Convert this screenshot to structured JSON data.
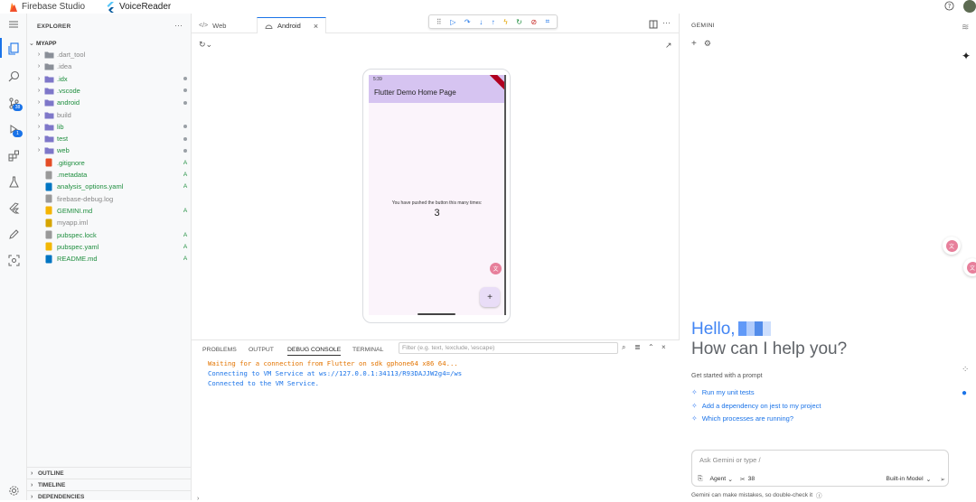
{
  "topbar": {
    "brand": "Firebase Studio",
    "project": "VoiceReader"
  },
  "activity": {
    "source_control_badge": "38",
    "debug_badge": "1"
  },
  "explorer": {
    "header": "EXPLORER",
    "root": "MYAPP",
    "items": [
      {
        "name": ".dart_tool",
        "status": "",
        "folder": true
      },
      {
        "name": ".idea",
        "status": "",
        "folder": true
      },
      {
        "name": ".idx",
        "status": "dot",
        "folder": true
      },
      {
        "name": ".vscode",
        "status": "dot",
        "folder": true
      },
      {
        "name": "android",
        "status": "dot",
        "folder": true
      },
      {
        "name": "build",
        "status": "",
        "folder": true
      },
      {
        "name": "lib",
        "status": "dot",
        "folder": true
      },
      {
        "name": "test",
        "status": "dot",
        "folder": true
      },
      {
        "name": "web",
        "status": "dot",
        "folder": true
      },
      {
        "name": ".gitignore",
        "status": "A",
        "folder": false
      },
      {
        "name": ".metadata",
        "status": "A",
        "folder": false
      },
      {
        "name": "analysis_options.yaml",
        "status": "A",
        "folder": false
      },
      {
        "name": "firebase-debug.log",
        "status": "",
        "folder": false
      },
      {
        "name": "GEMINI.md",
        "status": "A",
        "folder": false
      },
      {
        "name": "myapp.iml",
        "status": "",
        "folder": false
      },
      {
        "name": "pubspec.lock",
        "status": "A",
        "folder": false
      },
      {
        "name": "pubspec.yaml",
        "status": "A",
        "folder": false
      },
      {
        "name": "README.md",
        "status": "A",
        "folder": false
      }
    ],
    "sections": [
      "OUTLINE",
      "TIMELINE",
      "DEPENDENCIES"
    ]
  },
  "editor": {
    "tabs": [
      {
        "label": "Web"
      },
      {
        "label": "Android"
      }
    ]
  },
  "phone": {
    "status_time": "5:39",
    "app_title": "Flutter Demo Home Page",
    "message": "You have pushed the button this many times:",
    "count": "3",
    "fab": "+"
  },
  "panel": {
    "tabs": [
      "PROBLEMS",
      "OUTPUT",
      "DEBUG CONSOLE",
      "TERMINAL"
    ],
    "filter_placeholder": "Filter (e.g. text, !exclude, \\escape)",
    "logs": [
      "Waiting for a connection from Flutter on sdk gphone64 x86 64...",
      "Connecting to VM Service at ws://127.0.0.1:34113/R93DAJJW2g4=/ws",
      "Connected to the VM Service."
    ]
  },
  "gemini": {
    "header": "GEMINI",
    "hello": "Hello,",
    "help": "How can I help you?",
    "started": "Get started with a prompt",
    "prompts": [
      "Run my unit tests",
      "Add a dependency on jest to my project",
      "Which processes are running?"
    ],
    "input_placeholder": "Ask Gemini or type /",
    "agent_label": "Agent",
    "tools_count": "38",
    "model_label": "Built-in Model",
    "disclaimer": "Gemini can make mistakes, so double-check it"
  }
}
